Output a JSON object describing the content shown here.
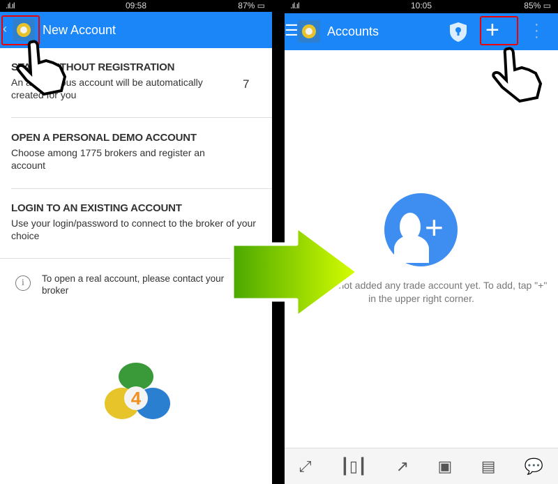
{
  "left": {
    "status": {
      "signal": ".ıl.ıl",
      "time": "09:58",
      "battery": "87%"
    },
    "header": {
      "title": "New Account",
      "back_icon": "chevron-left-icon"
    },
    "options": [
      {
        "title": "START WITHOUT REGISTRATION",
        "desc": "An anonymous account will be automatically created for you"
      },
      {
        "title": "OPEN A PERSONAL DEMO ACCOUNT",
        "desc": "Choose among 1775 brokers and register an account"
      },
      {
        "title": "LOGIN TO AN EXISTING ACCOUNT",
        "desc": "Use your login/password to connect to the broker of your choice"
      }
    ],
    "stray_mark": "7",
    "info": "To open a real account, please contact your broker",
    "logo_number": "4"
  },
  "right": {
    "status": {
      "signal": ".ıl.ıl",
      "time": "10:05",
      "battery": "85%"
    },
    "header": {
      "title": "Accounts"
    },
    "empty_text": "You have not added any trade account yet. To add, tap \"+\" in the upper right corner.",
    "nav": [
      "trade-icon",
      "quotes-icon",
      "chart-icon",
      "mailbox-icon",
      "news-icon",
      "chat-icon"
    ]
  },
  "colors": {
    "header": "#1a86f8",
    "highlight": "#e00000",
    "arrow": "#b8f000"
  }
}
